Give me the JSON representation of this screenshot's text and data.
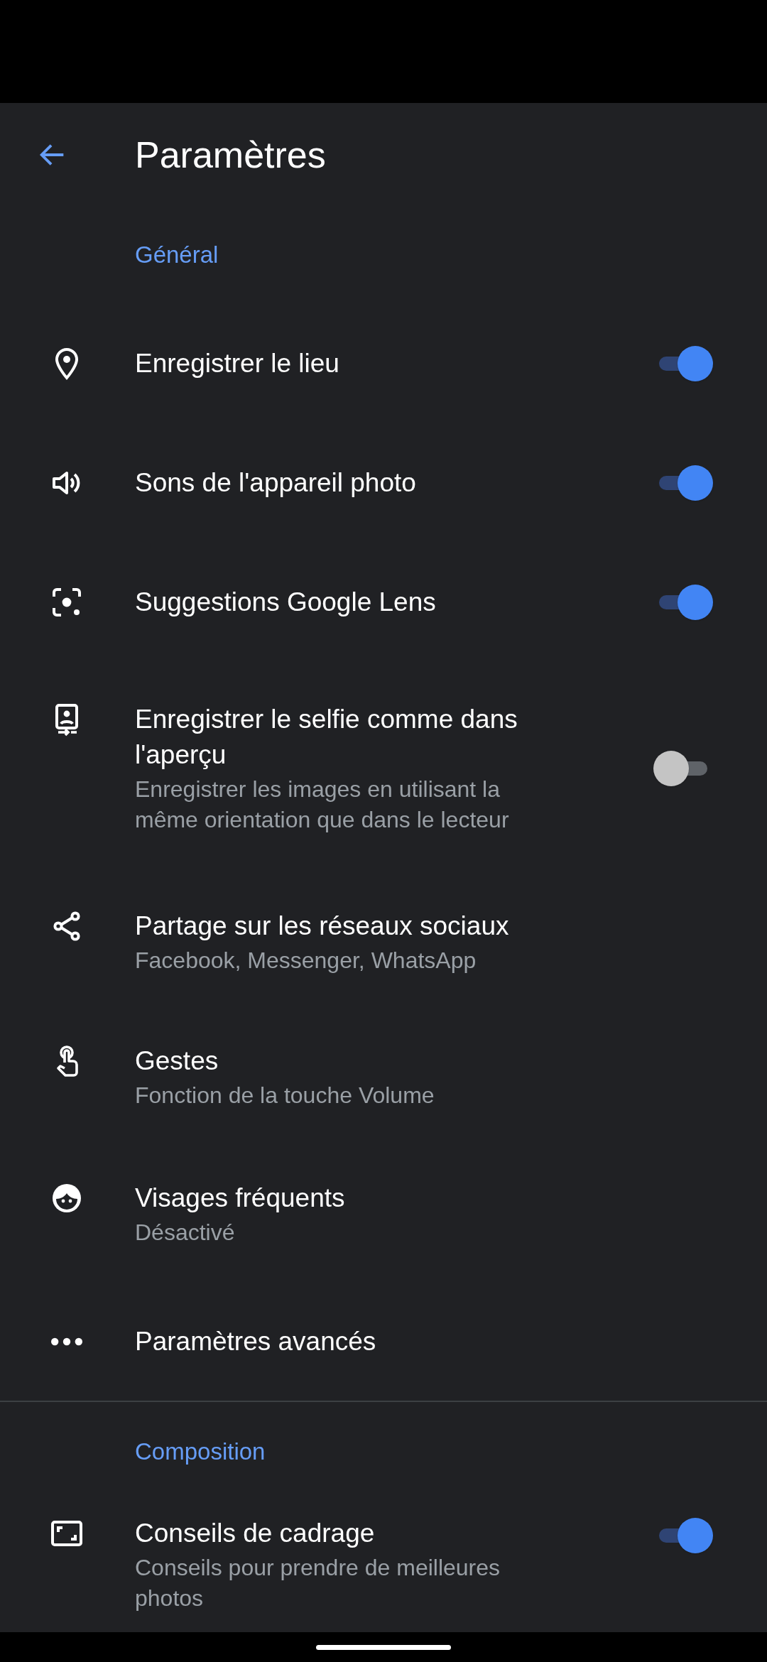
{
  "app_bar": {
    "title": "Paramètres"
  },
  "sections": [
    {
      "title": "Général",
      "items": [
        {
          "kind": "toggle",
          "title": "Enregistrer le lieu",
          "on": true
        },
        {
          "kind": "toggle",
          "title": "Sons de l'appareil photo",
          "on": true
        },
        {
          "kind": "toggle",
          "title": "Suggestions Google Lens",
          "on": true
        },
        {
          "kind": "toggle",
          "title": "Enregistrer le selfie comme dans l'aperçu",
          "subtitle": "Enregistrer les images en utilisant la même orientation que dans le lecteur",
          "on": false
        },
        {
          "kind": "link",
          "title": "Partage sur les réseaux sociaux",
          "subtitle": "Facebook, Messenger, WhatsApp"
        },
        {
          "kind": "link",
          "title": "Gestes",
          "subtitle": "Fonction de la touche Volume"
        },
        {
          "kind": "link",
          "title": "Visages fréquents",
          "subtitle": "Désactivé"
        },
        {
          "kind": "link",
          "title": "Paramètres avancés"
        }
      ]
    },
    {
      "title": "Composition",
      "items": [
        {
          "kind": "toggle",
          "title": "Conseils de cadrage",
          "subtitle": "Conseils pour prendre de meilleures photos",
          "on": true
        }
      ]
    }
  ]
}
